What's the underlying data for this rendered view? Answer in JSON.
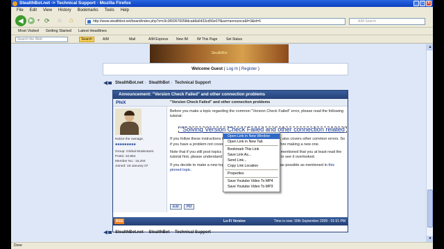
{
  "window": {
    "title": "StealthBot.net -> Technical Support - Mozilla Firefox"
  },
  "menu": [
    "File",
    "Edit",
    "View",
    "History",
    "Bookmarks",
    "Tools",
    "Help"
  ],
  "nav": {
    "url": "http://www.stealthbot.net/board/index.php?s=c9c3659576058dcab8a6433cd56e07f&act=announce&f=3&id=6",
    "search_placeholder": "AIM Search"
  },
  "bookmarks": [
    "Most Visited",
    "Getting Started",
    "Latest Headlines"
  ],
  "toolbar": {
    "search_placeholder": "Search the Web",
    "search_button": "Search",
    "items": [
      "AIM",
      "Mail",
      "AIM Express",
      "New IM",
      "IM This Page",
      "Set Status"
    ]
  },
  "page": {
    "guest": {
      "welcome": "Welcome Guest",
      "login": "Log In",
      "register": "Register"
    },
    "breadcrumb": [
      "StealthBot.net",
      "StealthBot",
      "Technical Support"
    ],
    "thread": {
      "header": "Announcement: \"Version Check Failed\" and other connection problems",
      "author": "PhiX",
      "post_title": "\"Version Check Failed\" and other connection problems",
      "user": {
        "tagline": "Notice the ownage.",
        "stars": "■■■■■■■■■",
        "group": "Group: Global Moderators",
        "posts": "Posts: 10,854",
        "member_no": "Member No.: 16,204",
        "joined": "Joined: 15-January 07"
      },
      "intro": "Before you make a topic regarding the common \"Version Check Failed\" error, please read the following tutorial:",
      "big_title": "\"Solving Version Check Failed and other connection related",
      "para1": "If you follow these instructions the problem should clear. The topic also covers other common errors. So if you have a problem not covered, please check out this topic before making a new one.",
      "para2": "Note that if you still post topics covered in the tutorial and it is not mentioned that you at least read the tutorial first, please understand that it's pretty disappointing for us to see it overlooked.",
      "para3_pre": "If you decide to make a new topic, please provide as much detail as possible as mentioned in",
      "para3_link": "this pinned topic",
      "quote_buttons": [
        "Edit",
        "PM"
      ]
    },
    "footer": {
      "rss": "RSS",
      "lofi": "Lo-Fi Version",
      "time": "Time is now: 30th September 2009 - 01:51 PM"
    }
  },
  "context_menu": {
    "items": [
      "Open Link in New Window",
      "Open Link in New Tab",
      "Bookmark This Link",
      "Save Link As...",
      "Send Link...",
      "Copy Link Location",
      "Properties",
      "Save Youtube Video To MP4",
      "Save Youtube Video To MP3"
    ],
    "selected_index": 0
  },
  "status": {
    "text": "Done"
  }
}
